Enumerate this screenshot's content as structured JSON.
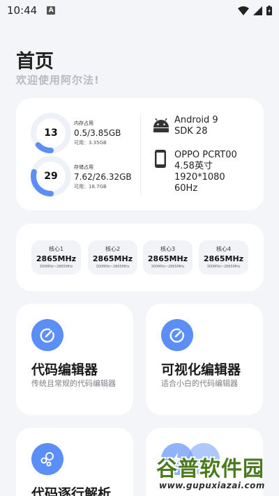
{
  "status_bar": {
    "time": "10:44",
    "notification": "A"
  },
  "header": {
    "title": "首页",
    "subtitle": "欢迎使用阿尔法!"
  },
  "info": {
    "memory": {
      "percent": "13",
      "label": "内存占用",
      "value": "0.5/3.85GB",
      "available": "可用：3.35GB",
      "fraction": 0.13
    },
    "storage": {
      "percent": "29",
      "label": "存储占用",
      "value": "7.62/26.32GB",
      "available": "可用：18.7GB",
      "fraction": 0.29
    },
    "os": {
      "name": "Android 9",
      "sdk": "SDK 28"
    },
    "device": {
      "model": "OPPO PCRT00",
      "screen_size": "4.58英寸",
      "resolution": "1920*1080",
      "refresh": "60Hz"
    }
  },
  "cores": [
    {
      "name": "核心1",
      "freq": "2865MHz",
      "range": "300MHz~2865MHz"
    },
    {
      "name": "核心2",
      "freq": "2865MHz",
      "range": "300MHz~2865MHz"
    },
    {
      "name": "核心3",
      "freq": "2865MHz",
      "range": "300MHz~2865MHz"
    },
    {
      "name": "核心4",
      "freq": "2865MHz",
      "range": "300MHz~2865MHz"
    }
  ],
  "tools": [
    {
      "title": "代码编辑器",
      "desc": "传统且常规的代码编辑器",
      "icon": "edit-icon"
    },
    {
      "title": "可视化编辑器",
      "desc": "适合小白的代码编辑器",
      "icon": "edit-icon"
    },
    {
      "title": "代码逐行解析",
      "desc": "",
      "icon": "bubbles-icon"
    }
  ],
  "watermark": {
    "title": "谷普软件园",
    "url": "www.gupuxiazai.com"
  },
  "colors": {
    "accent": "#5b8ef7",
    "ring_track": "#eef1f8",
    "background": "#f4f5f8"
  }
}
